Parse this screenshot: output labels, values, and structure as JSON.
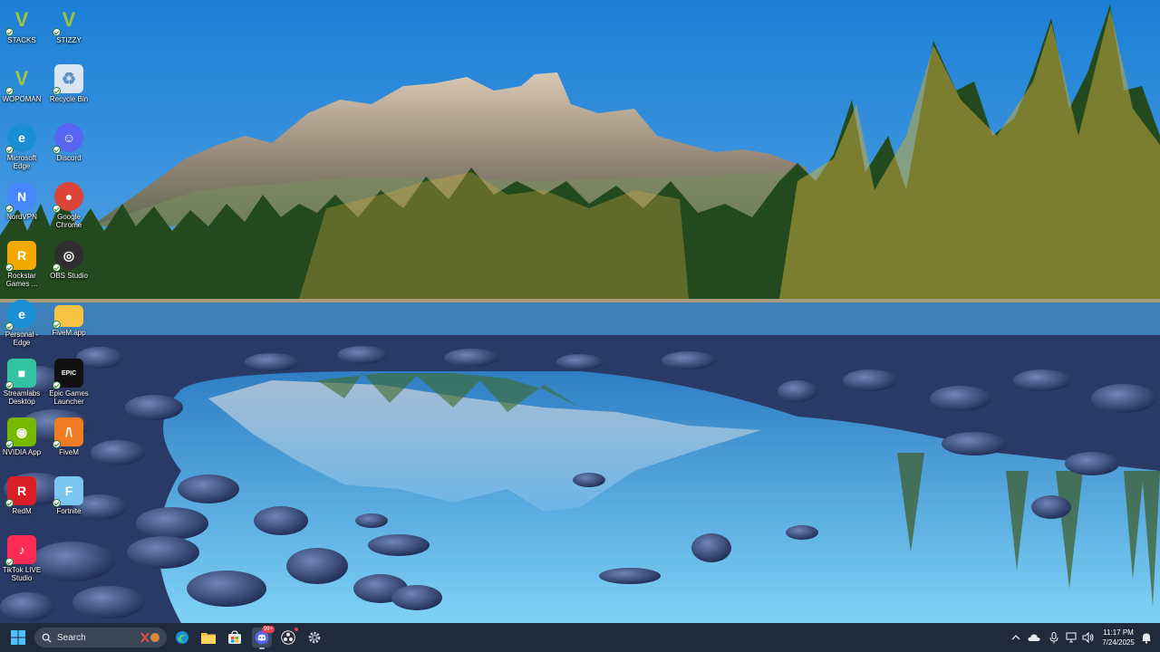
{
  "desktop": {
    "icons": [
      {
        "label": "STACKS",
        "icon": "gta-v-icon",
        "color": "#3a3a1a"
      },
      {
        "label": "STIZZY",
        "icon": "gta-v-icon",
        "color": "#3a3a1a"
      },
      {
        "label": "WOPOMAN",
        "icon": "gta-v-icon",
        "color": "#3a3a1a"
      },
      {
        "label": "Recycle Bin",
        "icon": "recycle-bin-icon",
        "color": "#d9e6f2"
      },
      {
        "label": "Microsoft Edge",
        "icon": "edge-icon",
        "color": "#1b8fd6"
      },
      {
        "label": "Discord",
        "icon": "discord-icon",
        "color": "#5865f2"
      },
      {
        "label": "NordVPN",
        "icon": "nordvpn-icon",
        "color": "#4687ff"
      },
      {
        "label": "Google Chrome",
        "icon": "chrome-icon",
        "color": "#db4437"
      },
      {
        "label": "Rockstar Games ...",
        "icon": "rockstar-icon",
        "color": "#f2a900"
      },
      {
        "label": "OBS Studio",
        "icon": "obs-icon",
        "color": "#302e31"
      },
      {
        "label": "Personal - Edge",
        "icon": "edge-icon",
        "color": "#1b8fd6"
      },
      {
        "label": "FiveM.app",
        "icon": "folder-icon",
        "color": "#f6c342"
      },
      {
        "label": "Streamlabs Desktop",
        "icon": "streamlabs-icon",
        "color": "#31c3a2"
      },
      {
        "label": "Epic Games Launcher",
        "icon": "epic-games-icon",
        "color": "#111111"
      },
      {
        "label": "NVIDIA App",
        "icon": "nvidia-icon",
        "color": "#76b900"
      },
      {
        "label": "FiveM",
        "icon": "fivem-icon",
        "color": "#f07b22"
      },
      {
        "label": "RedM",
        "icon": "redm-icon",
        "color": "#d81f26"
      },
      {
        "label": "Fortnite",
        "icon": "fortnite-icon",
        "color": "#7ac6f0"
      },
      {
        "label": "TikTok LIVE Studio",
        "icon": "tiktok-live-icon",
        "color": "#fe2c55"
      }
    ]
  },
  "taskbar": {
    "search_placeholder": "Search",
    "apps": [
      {
        "name": "edge",
        "icon": "edge-icon"
      },
      {
        "name": "file-explorer",
        "icon": "folder-icon"
      },
      {
        "name": "microsoft-store",
        "icon": "store-icon"
      },
      {
        "name": "discord",
        "icon": "discord-icon",
        "badge": "99+"
      },
      {
        "name": "obs",
        "icon": "obs-icon"
      },
      {
        "name": "settings",
        "icon": "gear-icon"
      }
    ],
    "clock": {
      "time": "11:17 PM",
      "date": "7/24/2025"
    }
  },
  "colors": {
    "taskbar_bg": "#1f2a3a",
    "sky_top": "#1c86d9",
    "sky_bottom": "#7cc3f0"
  }
}
